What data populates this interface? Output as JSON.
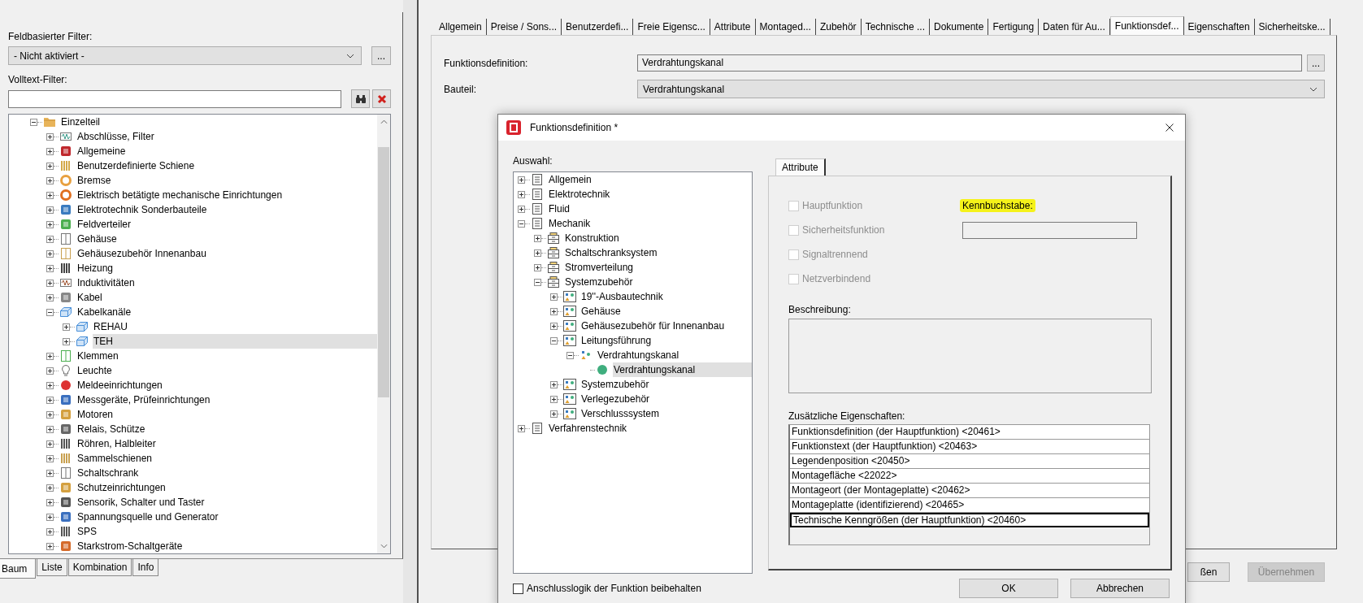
{
  "left_panel": {
    "field_filter": {
      "label": "Feldbasierter Filter:",
      "value": "- Nicht aktiviert -",
      "more_button": "..."
    },
    "fulltext_filter": {
      "label": "Volltext-Filter:"
    },
    "tree": [
      {
        "label": "Einzelteil",
        "expanded": true,
        "selected": false,
        "children": [
          {
            "label": "Abschlüsse, Filter",
            "expanded": false,
            "selected": false
          },
          {
            "label": "Allgemeine",
            "expanded": false,
            "selected": false
          },
          {
            "label": "Benutzerdefinierte Schiene",
            "expanded": false,
            "selected": false
          },
          {
            "label": "Bremse",
            "expanded": false,
            "selected": false
          },
          {
            "label": "Elektrisch betätigte mechanische Einrichtungen",
            "expanded": false,
            "selected": false
          },
          {
            "label": "Elektrotechnik Sonderbauteile",
            "expanded": false,
            "selected": false
          },
          {
            "label": "Feldverteiler",
            "expanded": false,
            "selected": false
          },
          {
            "label": "Gehäuse",
            "expanded": false,
            "selected": false
          },
          {
            "label": "Gehäusezubehör Innenanbau",
            "expanded": false,
            "selected": false
          },
          {
            "label": "Heizung",
            "expanded": false,
            "selected": false
          },
          {
            "label": "Induktivitäten",
            "expanded": false,
            "selected": false
          },
          {
            "label": "Kabel",
            "expanded": false,
            "selected": false
          },
          {
            "label": "Kabelkanäle",
            "expanded": true,
            "selected": false,
            "children": [
              {
                "label": "REHAU",
                "expanded": false,
                "selected": false
              },
              {
                "label": "TEH",
                "expanded": false,
                "selected": true
              }
            ]
          },
          {
            "label": "Klemmen",
            "expanded": false,
            "selected": false
          },
          {
            "label": "Leuchte",
            "expanded": false,
            "selected": false
          },
          {
            "label": "Meldeeinrichtungen",
            "expanded": false,
            "selected": false
          },
          {
            "label": "Messgeräte, Prüfeinrichtungen",
            "expanded": false,
            "selected": false
          },
          {
            "label": "Motoren",
            "expanded": false,
            "selected": false
          },
          {
            "label": "Relais, Schütze",
            "expanded": false,
            "selected": false
          },
          {
            "label": "Röhren, Halbleiter",
            "expanded": false,
            "selected": false
          },
          {
            "label": "Sammelschienen",
            "expanded": false,
            "selected": false
          },
          {
            "label": "Schaltschrank",
            "expanded": false,
            "selected": false
          },
          {
            "label": "Schutzeinrichtungen",
            "expanded": false,
            "selected": false
          },
          {
            "label": "Sensorik, Schalter und Taster",
            "expanded": false,
            "selected": false
          },
          {
            "label": "Spannungsquelle und Generator",
            "expanded": false,
            "selected": false
          },
          {
            "label": "SPS",
            "expanded": false,
            "selected": false
          },
          {
            "label": "Starkstrom-Schaltgeräte",
            "expanded": false,
            "selected": false
          }
        ]
      }
    ],
    "tabs": [
      {
        "label": "Baum",
        "selected": true
      },
      {
        "label": "Liste",
        "selected": false
      },
      {
        "label": "Kombination",
        "selected": false
      },
      {
        "label": "Info",
        "selected": false
      }
    ]
  },
  "main_panel": {
    "tabs": [
      {
        "label": "Allgemein",
        "selected": false
      },
      {
        "label": "Preise / Sons...",
        "selected": false
      },
      {
        "label": "Benutzerdefi...",
        "selected": false
      },
      {
        "label": "Freie Eigensc...",
        "selected": false
      },
      {
        "label": "Attribute",
        "selected": false
      },
      {
        "label": "Montaged...",
        "selected": false
      },
      {
        "label": "Zubehör",
        "selected": false
      },
      {
        "label": "Technische ...",
        "selected": false
      },
      {
        "label": "Dokumente",
        "selected": false
      },
      {
        "label": "Fertigung",
        "selected": false
      },
      {
        "label": "Daten für Au...",
        "selected": false
      },
      {
        "label": "Funktionsdef...",
        "selected": true
      },
      {
        "label": "Eigenschaften",
        "selected": false
      },
      {
        "label": "Sicherheitske...",
        "selected": false
      }
    ],
    "function_definition": {
      "label": "Funktionsdefinition:",
      "value": "Verdrahtungskanal",
      "more_button": "..."
    },
    "component": {
      "label": "Bauteil:",
      "value": "Verdrahtungskanal"
    },
    "buttons": [
      {
        "label": "ßen",
        "disabled": false
      },
      {
        "label": "Übernehmen",
        "disabled": true
      }
    ]
  },
  "dialog": {
    "title": "Funktionsdefinition *",
    "selection_label": "Auswahl:",
    "tree": [
      {
        "label": "Allgemein",
        "expanded": false,
        "selected": false
      },
      {
        "label": "Elektrotechnik",
        "expanded": false,
        "selected": false
      },
      {
        "label": "Fluid",
        "expanded": false,
        "selected": false
      },
      {
        "label": "Mechanik",
        "expanded": true,
        "selected": false,
        "children": [
          {
            "label": "Konstruktion",
            "expanded": false,
            "selected": false
          },
          {
            "label": "Schaltschranksystem",
            "expanded": false,
            "selected": false
          },
          {
            "label": "Stromverteilung",
            "expanded": false,
            "selected": false
          },
          {
            "label": "Systemzubehör",
            "expanded": true,
            "selected": false,
            "children": [
              {
                "label": "19''-Ausbautechnik",
                "expanded": false,
                "selected": false
              },
              {
                "label": "Gehäuse",
                "expanded": false,
                "selected": false
              },
              {
                "label": "Gehäusezubehör für Innenanbau",
                "expanded": false,
                "selected": false
              },
              {
                "label": "Leitungsführung",
                "expanded": true,
                "selected": false,
                "children": [
                  {
                    "label": "Verdrahtungskanal",
                    "expanded": true,
                    "selected": false,
                    "children": [
                      {
                        "label": "Verdrahtungskanal",
                        "selected": true
                      }
                    ]
                  }
                ]
              },
              {
                "label": "Systemzubehör",
                "expanded": false,
                "selected": false
              },
              {
                "label": "Verlegezubehör",
                "expanded": false,
                "selected": false
              },
              {
                "label": "Verschlusssystem",
                "expanded": false,
                "selected": false
              }
            ]
          }
        ]
      },
      {
        "label": "Verfahrenstechnik",
        "expanded": false,
        "selected": false
      }
    ],
    "tabs": [
      {
        "label": "Attribute",
        "selected": true
      }
    ],
    "checkboxes": [
      {
        "label": "Hauptfunktion",
        "checked": false,
        "disabled": true
      },
      {
        "label": "Sicherheitsfunktion",
        "checked": false,
        "disabled": true
      },
      {
        "label": "Signaltrennend",
        "checked": false,
        "disabled": true
      },
      {
        "label": "Netzverbindend",
        "checked": false,
        "disabled": true
      }
    ],
    "letter_code": {
      "label": "Kennbuchstabe:",
      "highlighted": true
    },
    "description_label": "Beschreibung:",
    "extra_properties": {
      "label": "Zusätzliche Eigenschaften:",
      "rows": [
        {
          "text": "Funktionsdefinition (der Hauptfunktion) <20461>",
          "focused": false
        },
        {
          "text": "Funktionstext (der Hauptfunktion) <20463>",
          "focused": false
        },
        {
          "text": "Legendenposition <20450>",
          "focused": false
        },
        {
          "text": "Montagefläche <22022>",
          "focused": false
        },
        {
          "text": "Montageort (der Montageplatte) <20462>",
          "focused": false
        },
        {
          "text": "Montageplatte (identifizierend) <20465>",
          "focused": false
        },
        {
          "text": "Technische Kenngrößen (der Hauptfunktion) <20460>",
          "focused": true
        }
      ]
    },
    "keep_logic": {
      "label": "Anschlusslogik der Funktion beibehalten",
      "checked": false
    },
    "buttons": [
      "OK",
      "Abbrechen"
    ]
  }
}
